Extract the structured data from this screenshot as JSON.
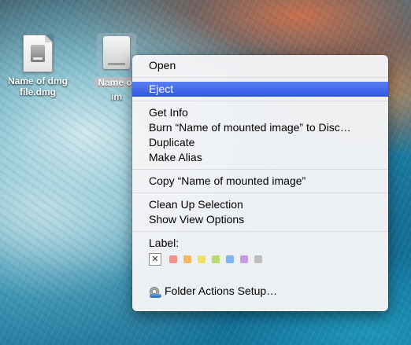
{
  "desktop": {
    "icons": [
      {
        "label_line1": "Name of dmg",
        "label_line2": "file.dmg"
      },
      {
        "label_line1": "Name of",
        "label_line2": "im"
      }
    ]
  },
  "context_menu": {
    "open": "Open",
    "eject": "Eject",
    "get_info": "Get Info",
    "burn": "Burn “Name of  mounted image” to Disc…",
    "duplicate": "Duplicate",
    "make_alias": "Make Alias",
    "copy": "Copy “Name of  mounted image”",
    "clean_up": "Clean Up Selection",
    "show_view_options": "Show View Options",
    "label_title": "Label:",
    "label_none_glyph": "✕",
    "label_colors": [
      "#f3918b",
      "#f7b660",
      "#f2df6a",
      "#b5dc6b",
      "#7fb4f2",
      "#c79ae6",
      "#bdbdbd"
    ],
    "folder_actions": "Folder Actions Setup…",
    "highlighted_item": "Eject"
  }
}
